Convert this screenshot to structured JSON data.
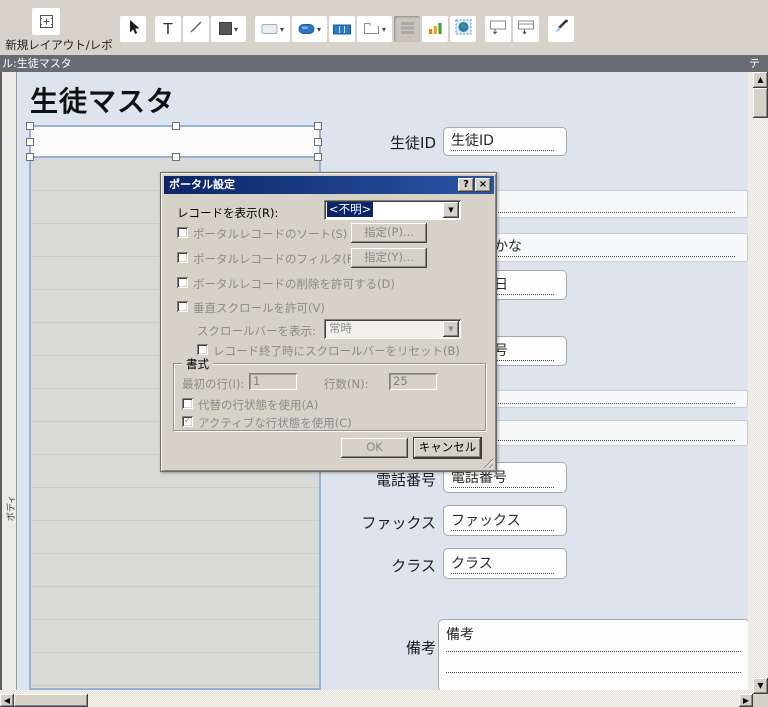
{
  "toolbar": {
    "new_layout_label": "新規レイアウト/レポート",
    "tools": [
      "select-tool",
      "text-tool",
      "line-tool",
      "shape-tool",
      "field-tool",
      "button-tool",
      "button-bar-tool",
      "tab-control-tool",
      "portal-tool",
      "chart-tool",
      "image-tool",
      "insert-field-tool",
      "insert-part-tool",
      "format-painter-tool"
    ],
    "text_tool_glyph": "T"
  },
  "status_bar": {
    "left_text": "ル:生徒マスタ",
    "right_text": "テ"
  },
  "layout": {
    "title": "生徒マスタ",
    "part_label": "ボディ",
    "fields": {
      "student_id": {
        "label": "生徒ID",
        "text": "生徒ID"
      },
      "name_band": {
        "text": ""
      },
      "kana_band": {
        "text": "かな"
      },
      "birth": {
        "text": "日"
      },
      "postal": {
        "text": "号"
      },
      "addr_band1": {
        "text": ""
      },
      "addr_band2": {
        "text": ""
      },
      "phone": {
        "label": "電話番号",
        "text": "電話番号"
      },
      "fax": {
        "label": "ファックス",
        "text": "ファックス"
      },
      "class": {
        "label": "クラス",
        "text": "クラス"
      },
      "notes": {
        "label": "備考",
        "text": "備考"
      }
    }
  },
  "dialog": {
    "title": "ポータル設定",
    "help_glyph": "?",
    "close_glyph": "×",
    "show_records_label": "レコードを表示(R):",
    "show_records_value": "<不明>",
    "sort_label": "ポータルレコードのソート(S)",
    "sort_button": "指定(P)...",
    "filter_label": "ポータルレコードのフィルタ(F)",
    "filter_button": "指定(Y)...",
    "allow_delete_label": "ポータルレコードの削除を許可する(D)",
    "vscroll_label": "垂直スクロールを許可(V)",
    "scrollbar_show_label": "スクロールバーを表示:",
    "scrollbar_show_value": "常時",
    "reset_scrollbar_label": "レコード終了時にスクロールバーをリセット(B)",
    "format_group_label": "書式",
    "first_row_label": "最初の行(I):",
    "first_row_value": "1",
    "row_count_label": "行数(N):",
    "row_count_value": "25",
    "alt_row_label": "代替の行状態を使用(A)",
    "active_row_label": "アクティブな行状態を使用(C)",
    "active_row_check": "✓",
    "ok_label": "OK",
    "cancel_label": "キャンセル"
  },
  "glyphs": {
    "up": "▲",
    "down": "▼",
    "left": "◀",
    "right": "▶",
    "combo_down": "▼",
    "dropdown": "▾"
  }
}
